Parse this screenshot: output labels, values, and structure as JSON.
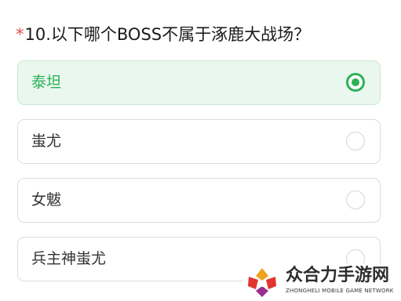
{
  "question": {
    "required_mark": "*",
    "text": "10.以下哪个BOSS不属于涿鹿大战场？"
  },
  "options": [
    {
      "label": "泰坦",
      "selected": true
    },
    {
      "label": "蚩尤",
      "selected": false
    },
    {
      "label": "女魃",
      "selected": false
    },
    {
      "label": "兵主神蚩尤",
      "selected": false
    }
  ],
  "colors": {
    "accent": "#2bb158",
    "selected_background": "#eaf7ee",
    "required": "#e2534a"
  },
  "watermark": {
    "title": "众合力手游网",
    "subtitle": "ZHONGHELI MOBILE GAME NETWORK",
    "logo_icon": "zhongheli-logo"
  }
}
